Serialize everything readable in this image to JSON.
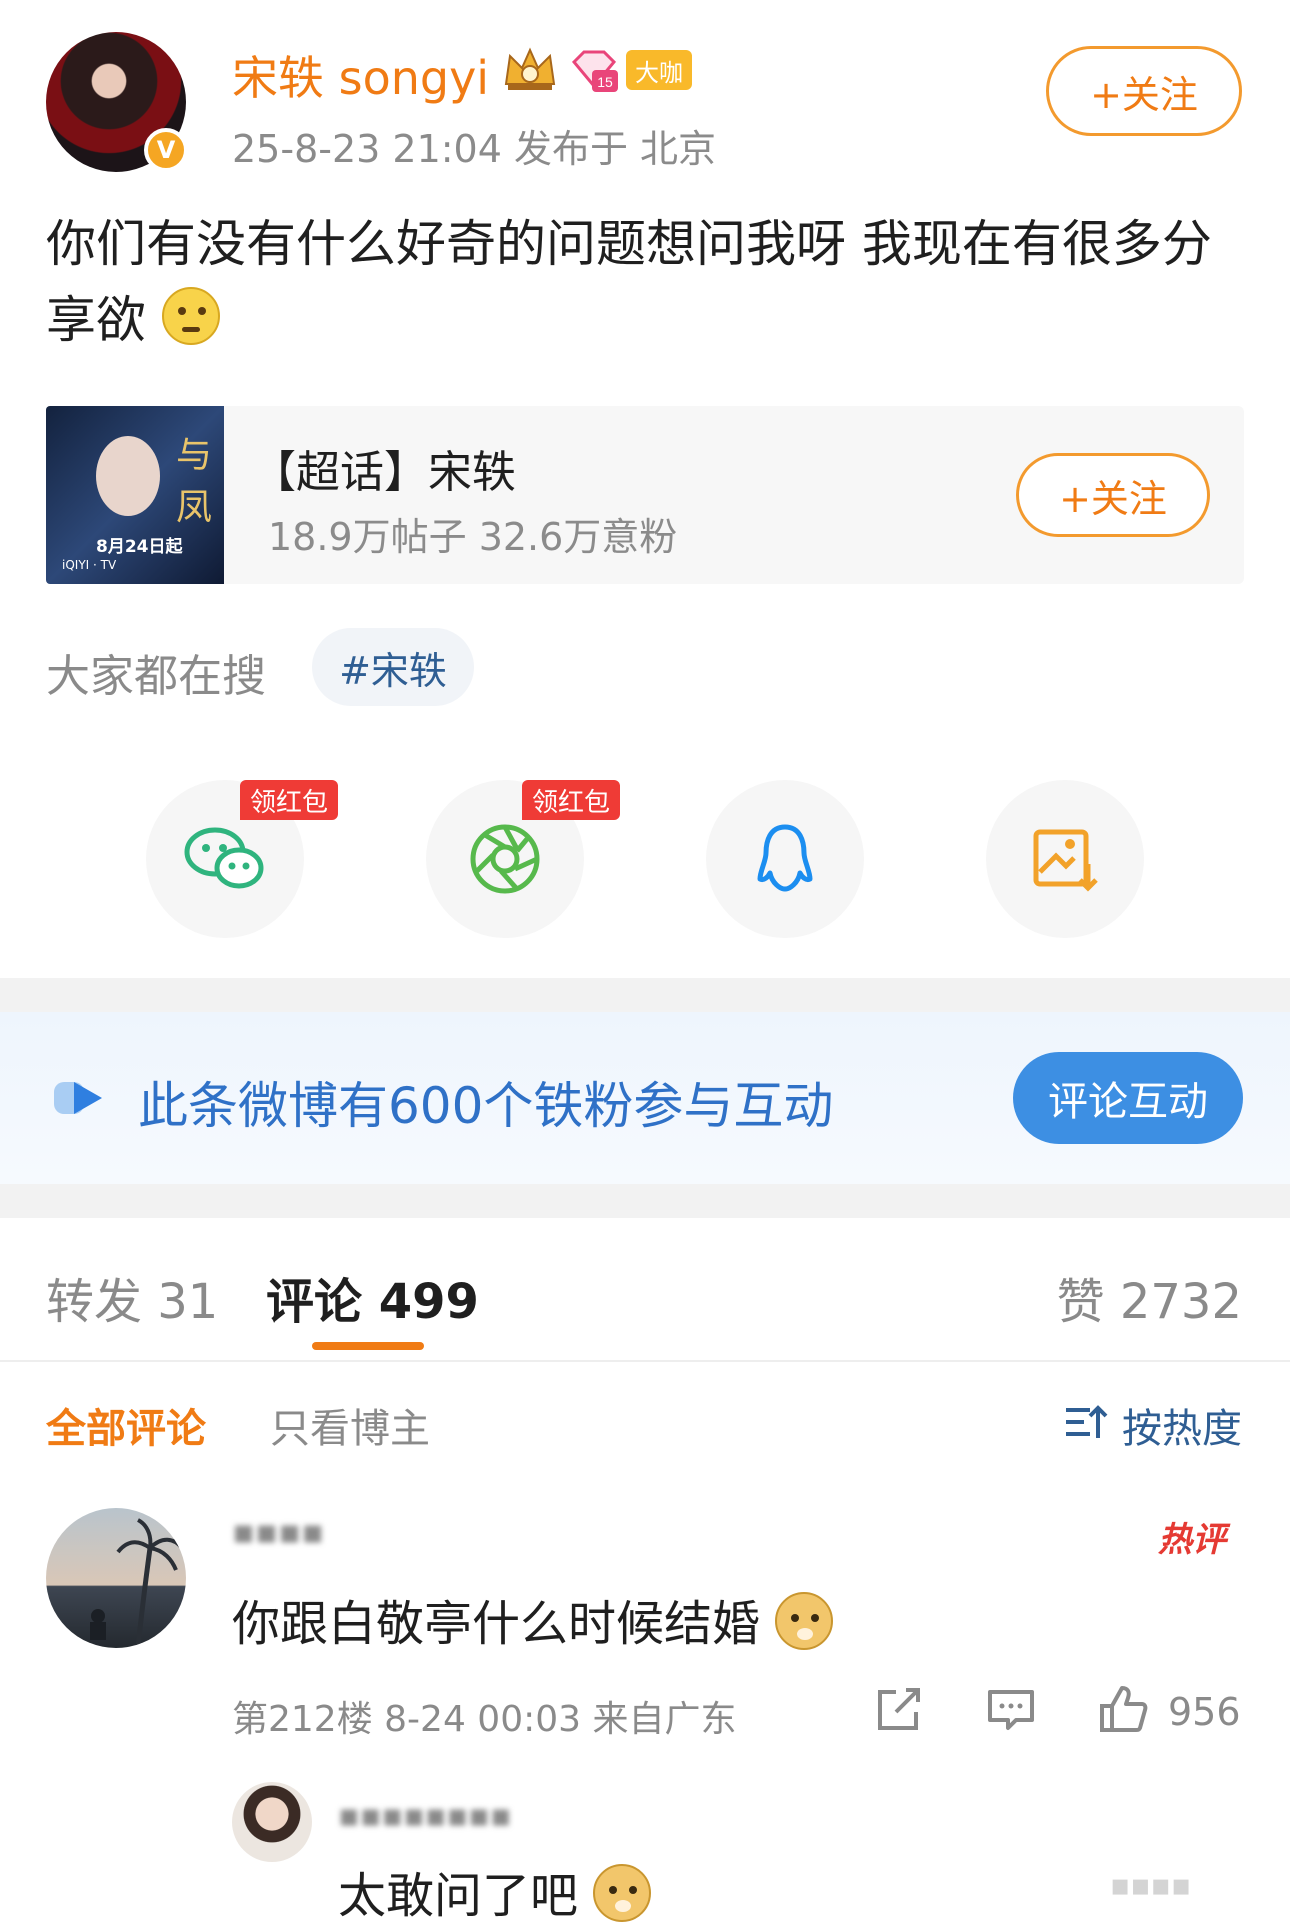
{
  "post": {
    "username": "宋轶 songyi",
    "badge_label": "大咖",
    "gem_level": "15",
    "meta": "25-8-23 21:04  发布于 北京",
    "follow_label": "+关注",
    "text": "你们有没有什么好奇的问题想问我呀 我现在有很多分享欲"
  },
  "topic": {
    "title": "【超话】宋轶",
    "stats": "18.9万帖子 32.6万意粉",
    "follow_label": "+关注",
    "thumb_date": "8月24日起"
  },
  "search": {
    "label": "大家都在搜",
    "tag": "#宋轶"
  },
  "share": {
    "redpack_label": "领红包",
    "items": [
      "wechat-icon",
      "moments-icon",
      "qq-icon",
      "save-image-icon"
    ]
  },
  "banner": {
    "text": "此条微博有600个铁粉参与互动",
    "button_label": "评论互动"
  },
  "tabs": {
    "repost": "转发 31",
    "comment": "评论 499",
    "like": "赞 2732"
  },
  "filters": {
    "all": "全部评论",
    "blogger_only": "只看博主",
    "sort": "按热度"
  },
  "comment": {
    "hot_badge": "热评",
    "text": "你跟白敬亭什么时候结婚",
    "meta": "第212楼 8-24 00:03 来自广东",
    "like_count": "956"
  },
  "reply": {
    "text": "太敢问了吧"
  },
  "colors": {
    "accent": "#f07b14",
    "link": "#2f5e93",
    "banner_blue": "#3d8fe3",
    "hot_red": "#e53a33"
  }
}
